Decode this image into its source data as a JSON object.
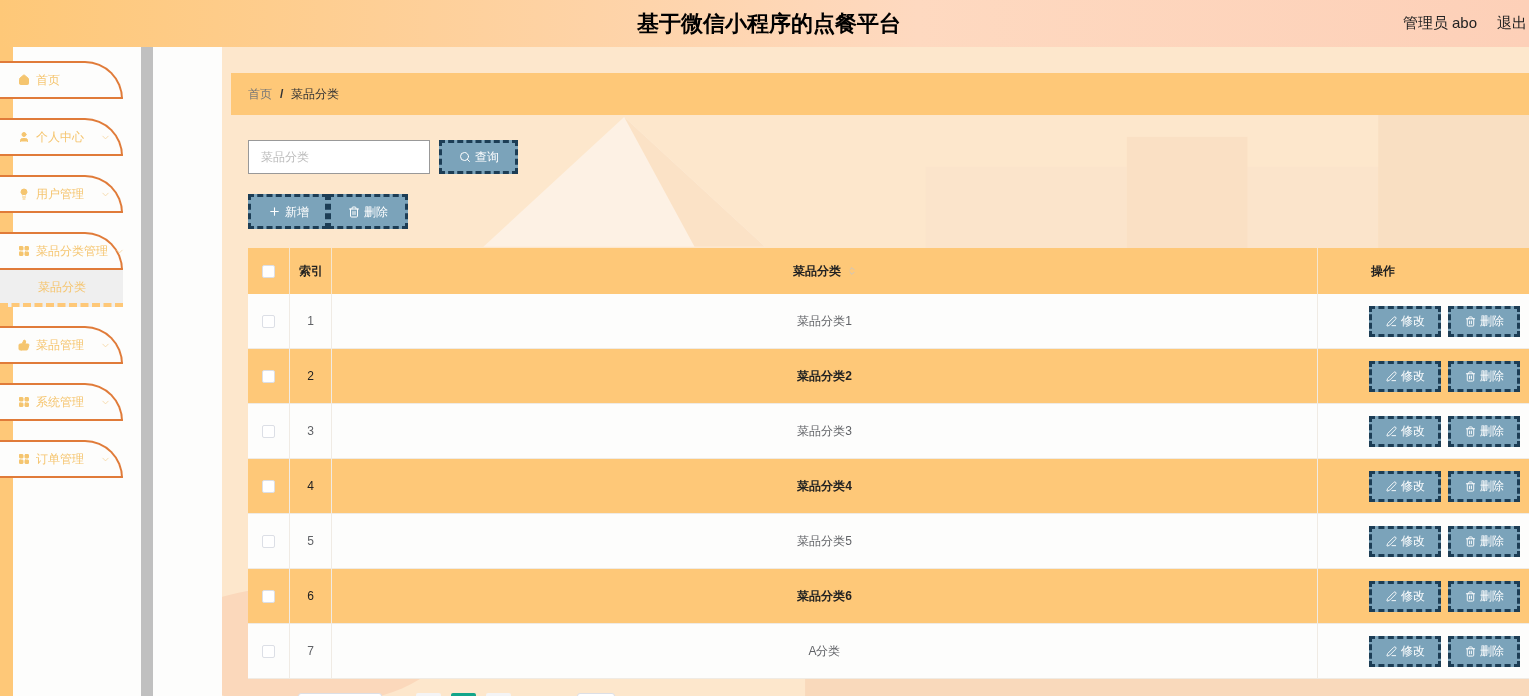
{
  "header": {
    "title": "基于微信小程序的点餐平台",
    "user": "管理员 abo",
    "logout": "退出"
  },
  "sidebar": {
    "items": [
      {
        "label": "首页",
        "kind": "home",
        "expandable": false
      },
      {
        "label": "个人中心",
        "kind": "user",
        "expandable": true
      },
      {
        "label": "用户管理",
        "kind": "bulb",
        "expandable": true
      },
      {
        "label": "菜品分类管理",
        "kind": "grid",
        "expandable": true,
        "children": [
          {
            "label": "菜品分类",
            "selected": true
          }
        ]
      },
      {
        "label": "菜品管理",
        "kind": "thumb",
        "expandable": true
      },
      {
        "label": "系统管理",
        "kind": "grid",
        "expandable": true
      },
      {
        "label": "订单管理",
        "kind": "grid",
        "expandable": true
      }
    ]
  },
  "breadcrumb": {
    "items": [
      "首页",
      "菜品分类"
    ],
    "separator": "/"
  },
  "search": {
    "placeholder": "菜品分类",
    "button": "查询"
  },
  "actions": [
    "新增",
    "删除"
  ],
  "table": {
    "columns": [
      "索引",
      "菜品分类",
      "操作"
    ],
    "header_checked": false,
    "rows": [
      {
        "index": "1",
        "name": "菜品分类1",
        "checked": false,
        "actions": [
          "修改",
          "删除"
        ]
      },
      {
        "index": "2",
        "name": "菜品分类2",
        "checked": false,
        "actions": [
          "修改",
          "删除"
        ]
      },
      {
        "index": "3",
        "name": "菜品分类3",
        "checked": false,
        "actions": [
          "修改",
          "删除"
        ]
      },
      {
        "index": "4",
        "name": "菜品分类4",
        "checked": false,
        "actions": [
          "修改",
          "删除"
        ]
      },
      {
        "index": "5",
        "name": "菜品分类5",
        "checked": false,
        "actions": [
          "修改",
          "删除"
        ]
      },
      {
        "index": "6",
        "name": "菜品分类6",
        "checked": false,
        "actions": [
          "修改",
          "删除"
        ]
      },
      {
        "index": "7",
        "name": "A分类",
        "checked": false,
        "actions": [
          "修改",
          "删除"
        ]
      }
    ]
  }
}
